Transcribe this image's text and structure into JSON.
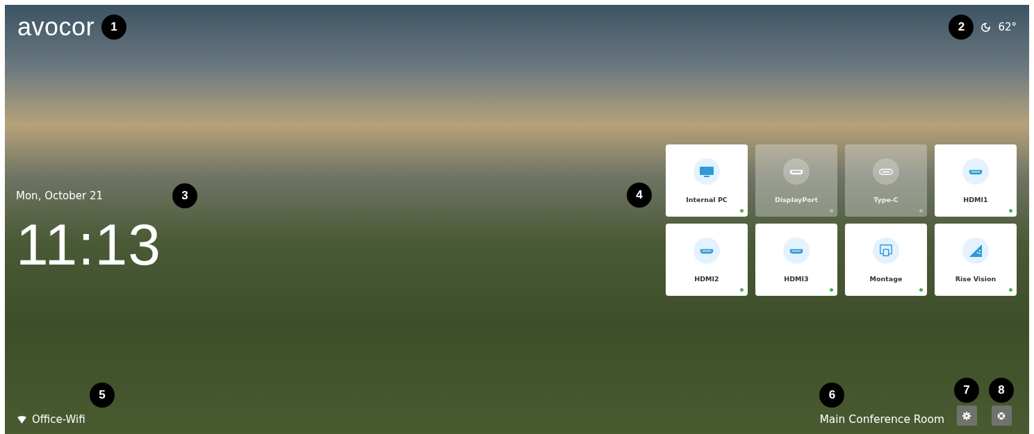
{
  "logo": {
    "text": "avocor",
    "callout": "1"
  },
  "weather": {
    "temperature": "62°",
    "callout": "2"
  },
  "clock": {
    "date": "Mon, October 21",
    "time": "11:13",
    "callout": "3"
  },
  "sources": {
    "callout": "4",
    "tiles": [
      {
        "label": "Internal PC",
        "kind": "monitor",
        "active": true,
        "color": "#4caf50"
      },
      {
        "label": "DisplayPort",
        "kind": "displayport",
        "active": false,
        "color": "#b8b8b8"
      },
      {
        "label": "Type-C",
        "kind": "usbc",
        "active": false,
        "color": "#b8b8b8"
      },
      {
        "label": "HDMI1",
        "kind": "hdmi",
        "active": true,
        "color": "#4caf50"
      },
      {
        "label": "HDMI2",
        "kind": "hdmi",
        "active": true,
        "color": "#4caf50"
      },
      {
        "label": "HDMI3",
        "kind": "hdmi",
        "active": true,
        "color": "#4caf50"
      },
      {
        "label": "Montage",
        "kind": "montage",
        "active": true,
        "color": "#4caf50"
      },
      {
        "label": "Rise Vision",
        "kind": "rise",
        "active": true,
        "color": "#4caf50"
      }
    ]
  },
  "network": {
    "name": "Office-Wifi",
    "callout": "5"
  },
  "room": {
    "name": "Main Conference Room",
    "callout": "6"
  },
  "buttons": [
    {
      "kind": "settings",
      "callout": "7"
    },
    {
      "kind": "support",
      "callout": "8"
    }
  ]
}
